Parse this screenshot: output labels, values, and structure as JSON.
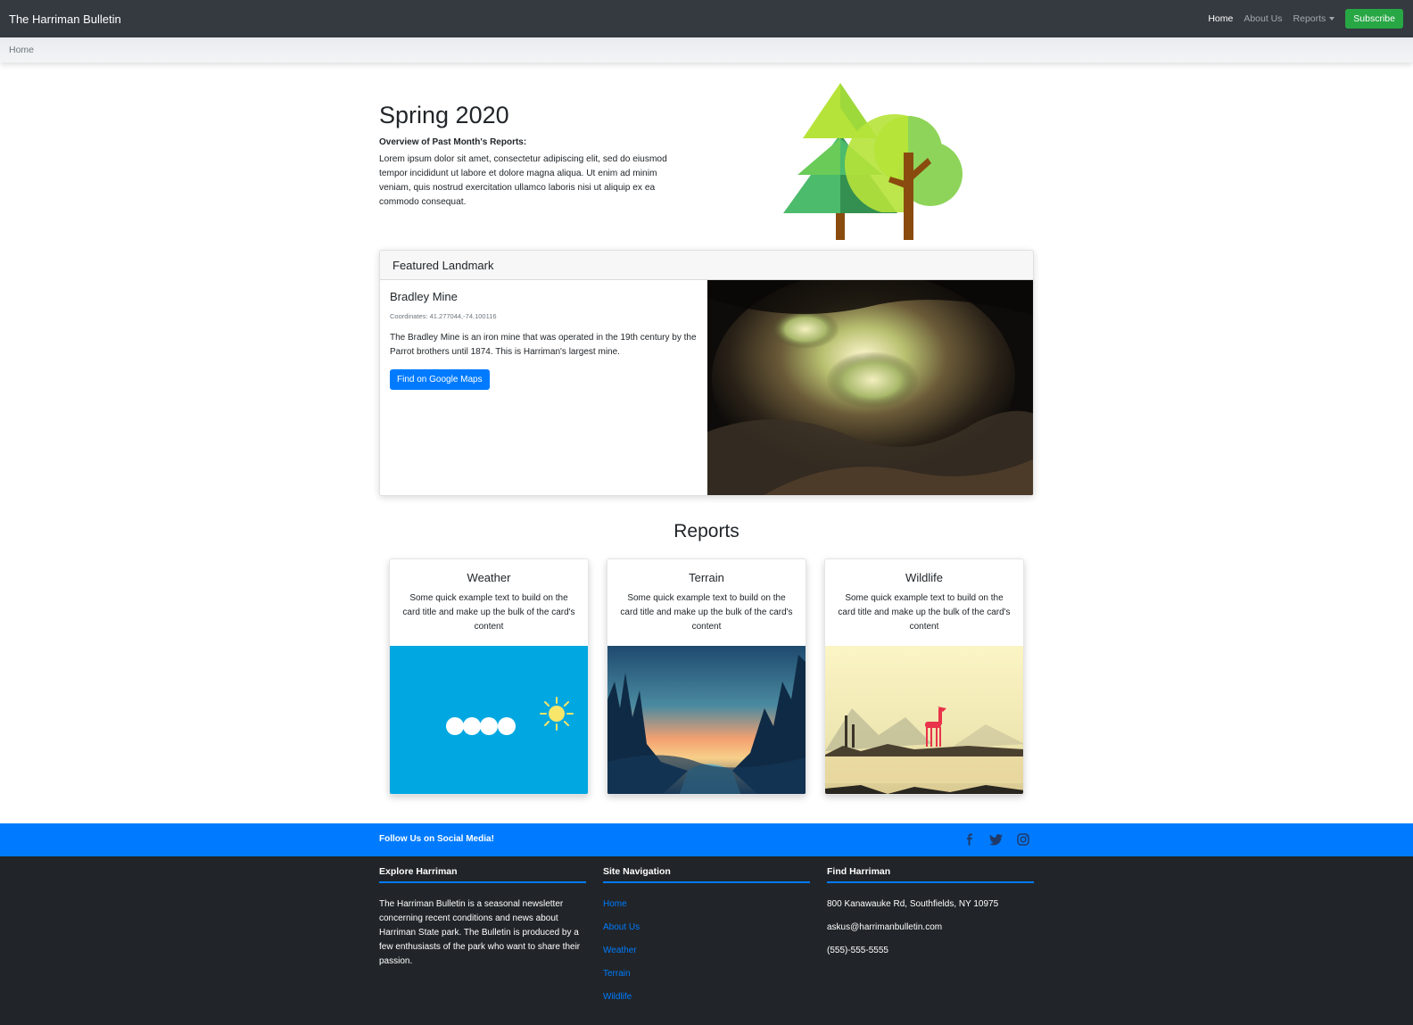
{
  "navbar": {
    "brand": "The Harriman Bulletin",
    "links": [
      {
        "label": "Home"
      },
      {
        "label": "About Us"
      },
      {
        "label": "Reports"
      }
    ],
    "subscribe_label": "Subscribe"
  },
  "breadcrumb": {
    "current": "Home"
  },
  "hero": {
    "title": "Spring 2020",
    "subtitle": "Overview of Past Month's Reports:",
    "text": "Lorem ipsum dolor sit amet, consectetur adipiscing elit, sed do eiusmod tempor incididunt ut labore et dolore magna aliqua. Ut enim ad minim veniam, quis nostrud exercitation ullamco laboris nisi ut aliquip ex ea commodo consequat."
  },
  "featured": {
    "header": "Featured Landmark",
    "title": "Bradley Mine",
    "coordinates": "Coordinates: 41.277044,-74.100116",
    "text": "The Bradley Mine is an iron mine that was operated in the 19th century by the Parrot brothers until 1874. This is Harriman's largest mine.",
    "button_label": "Find on Google Maps"
  },
  "reports": {
    "heading": "Reports",
    "cards": [
      {
        "title": "Weather",
        "text": "Some quick example text to build on the card title and make up the bulk of the card's content"
      },
      {
        "title": "Terrain",
        "text": "Some quick example text to build on the card title and make up the bulk of the card's content"
      },
      {
        "title": "Wildlife",
        "text": "Some quick example text to build on the card title and make up the bulk of the card's content"
      }
    ]
  },
  "social": {
    "text": "Follow Us on Social Media!",
    "icons": [
      "facebook-icon",
      "twitter-icon",
      "instagram-icon"
    ]
  },
  "footer": {
    "explore": {
      "heading": "Explore Harriman",
      "text": "The Harriman Bulletin is a seasonal newsletter concerning recent conditions and news about Harriman State park. The Bulletin is produced by a few enthusiasts of the park who want to share their passion."
    },
    "navigation": {
      "heading": "Site Navigation",
      "links": [
        "Home",
        "About Us",
        "Weather",
        "Terrain",
        "Wildlife"
      ]
    },
    "find": {
      "heading": "Find Harriman",
      "address": "800 Kanawauke Rd, Southfields, NY 10975",
      "email": "askus@harrimanbulletin.com",
      "phone": "(555)-555-5555"
    }
  },
  "colors": {
    "navbar": "#343a40",
    "primary": "#007bff",
    "success": "#28a745",
    "footer": "#212529"
  }
}
